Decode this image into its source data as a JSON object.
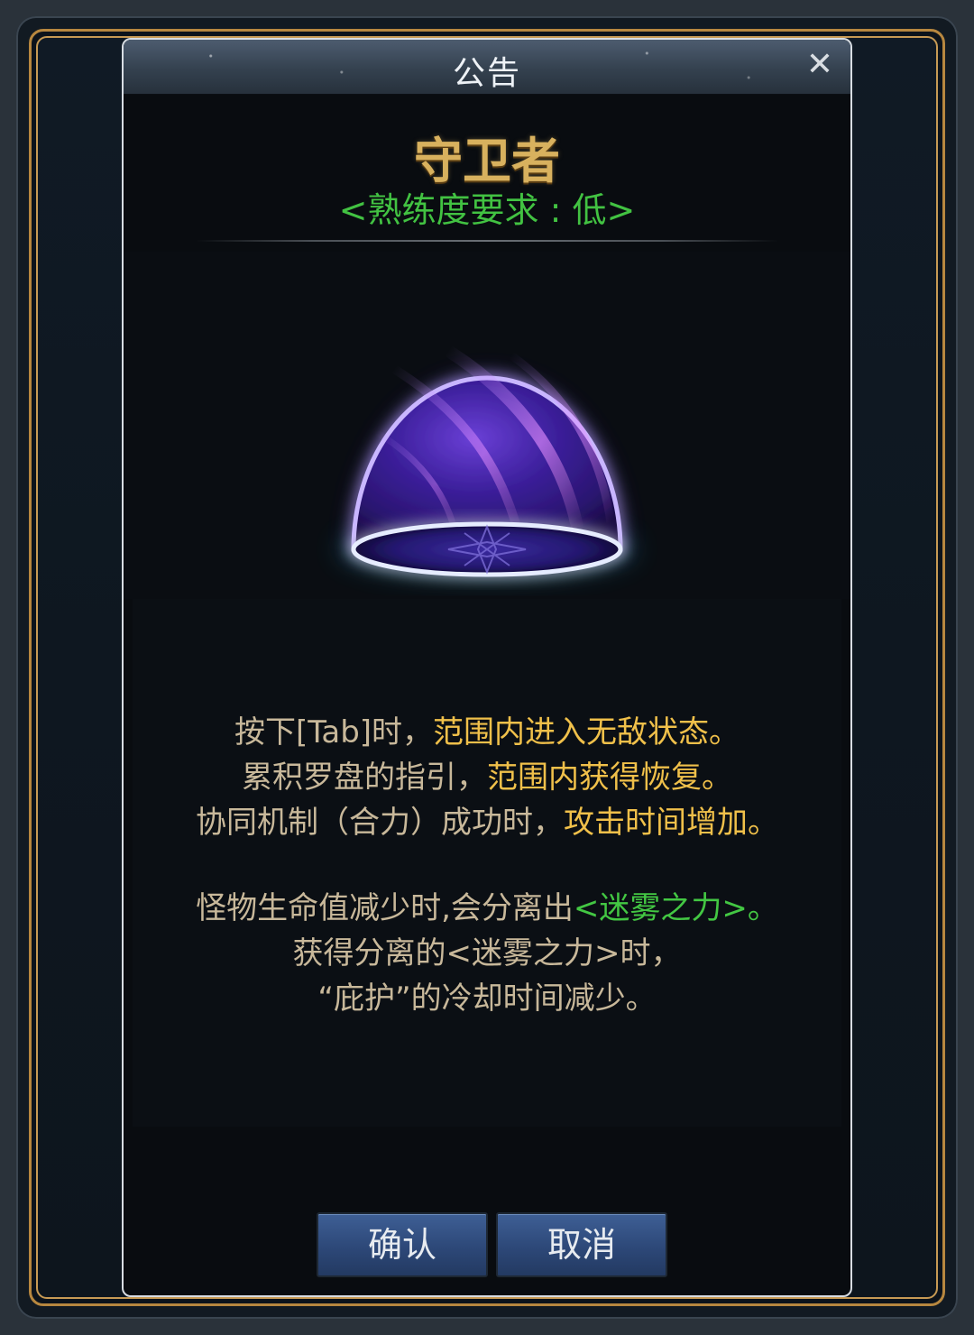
{
  "dialog": {
    "title": "公告",
    "close_symbol": "✕"
  },
  "skill": {
    "name": "守卫者",
    "requirement": "<熟练度要求 : 低>"
  },
  "description": {
    "lines": [
      {
        "a": "按下[Tab]时，",
        "b": "范围内进入无敌状态。"
      },
      {
        "a": "累积罗盘的指引，",
        "b": "范围内获得恢复。"
      },
      {
        "a": "协同机制（合力）成功时，",
        "b": "攻击时间增加。"
      },
      {
        "a": "怪物生命值减少时,会分离出",
        "b": "<迷雾之力>。"
      },
      {
        "a": "获得分离的<迷雾之力>时，"
      },
      {
        "a": "“庇护”的冷却时间减少。"
      }
    ]
  },
  "buttons": {
    "confirm": "确认",
    "cancel": "取消"
  },
  "colors": {
    "skill_name": "#d8b15e",
    "requirement": "#42c242",
    "highlight": "#f0c04a",
    "green_text": "#43c743",
    "body_text": "#c8b89a",
    "button": "#2d4878",
    "gold_frame": "#b7873f"
  },
  "icons": {
    "skill_art": "shield-dome-icon",
    "close": "close-icon"
  }
}
